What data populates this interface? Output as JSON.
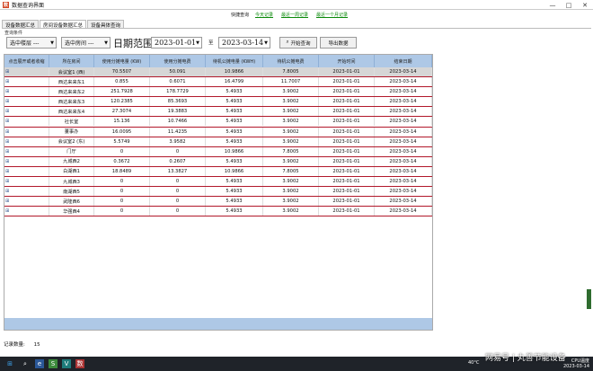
{
  "window": {
    "title": "数据查询界面",
    "app_icon": "app-icon",
    "min": "—",
    "max": "□",
    "close": "✕"
  },
  "quickbar": {
    "label": "快捷查询",
    "links": [
      "今天记录",
      "最近一周记录",
      "最近一个月记录"
    ]
  },
  "tabs": [
    "设备数据汇总",
    "房间设备数据汇总",
    "设备具体查询"
  ],
  "section_title": "查询条件",
  "toolbar": {
    "building_select": "选中楼层 ---",
    "room_select": "选中房间 ---",
    "date_label": "日期范围:",
    "start_date": "2023-01-01",
    "to_label": "至",
    "end_date": "2023-03-14",
    "query_button": "开始查询",
    "export_button": "导出数据"
  },
  "table": {
    "headers": [
      "点击展开或者收缩",
      "所在房间",
      "使用分摊电量 (KW)",
      "使用分摊电费",
      "待机公摊电量 (KWH)",
      "待机公摊电费",
      "开始时间",
      "结束日期"
    ],
    "rows": [
      [
        "会议室1 (西)",
        "70.5507",
        "50.091",
        "10.9866",
        "7.8005",
        "2023-01-01",
        "2023-03-14"
      ],
      [
        "西达来来东1",
        "0.855",
        "0.6071",
        "16.4799",
        "11.7007",
        "2023-01-01",
        "2023-03-14"
      ],
      [
        "西达来来东2",
        "251.7928",
        "178.7729",
        "5.4933",
        "3.9002",
        "2023-01-01",
        "2023-03-14"
      ],
      [
        "西达来来东3",
        "120.2385",
        "85.3693",
        "5.4933",
        "3.9002",
        "2023-01-01",
        "2023-03-14"
      ],
      [
        "西达来来东4",
        "27.3074",
        "19.3883",
        "5.4933",
        "3.9002",
        "2023-01-01",
        "2023-03-14"
      ],
      [
        "社长室",
        "15.136",
        "10.7466",
        "5.4933",
        "3.9002",
        "2023-01-01",
        "2023-03-14"
      ],
      [
        "董事办",
        "16.0095",
        "11.4235",
        "5.4933",
        "3.9002",
        "2023-01-01",
        "2023-03-14"
      ],
      [
        "会议室2 (东)",
        "5.5749",
        "3.9582",
        "5.4933",
        "3.9002",
        "2023-01-01",
        "2023-03-14"
      ],
      [
        "门厅",
        "0",
        "0",
        "10.9866",
        "7.8005",
        "2023-01-01",
        "2023-03-14"
      ],
      [
        "九城西2",
        "0.3672",
        "0.2607",
        "5.4933",
        "3.9002",
        "2023-01-01",
        "2023-03-14"
      ],
      [
        "白湖西1",
        "18.8489",
        "13.3827",
        "10.9866",
        "7.8005",
        "2023-01-01",
        "2023-03-14"
      ],
      [
        "九城西3",
        "0",
        "0",
        "5.4933",
        "3.9002",
        "2023-01-01",
        "2023-03-14"
      ],
      [
        "南湖西5",
        "0",
        "0",
        "5.4933",
        "3.9002",
        "2023-01-01",
        "2023-03-14"
      ],
      [
        "武隆西6",
        "0",
        "0",
        "5.4933",
        "3.9002",
        "2023-01-01",
        "2023-03-14"
      ],
      [
        "华强西4",
        "0",
        "0",
        "5.4933",
        "3.9002",
        "2023-01-01",
        "2023-03-14"
      ]
    ],
    "row_icon": "⊞"
  },
  "status": {
    "label": "记录数量:",
    "count": "15"
  },
  "taskbar": {
    "start_icon": "⊞",
    "search_icon": "⌕",
    "tray_time": "CPU温度",
    "date": "2023-03-14",
    "temp": "40°C"
  },
  "watermark": "网易号 | 丸善节能设备"
}
